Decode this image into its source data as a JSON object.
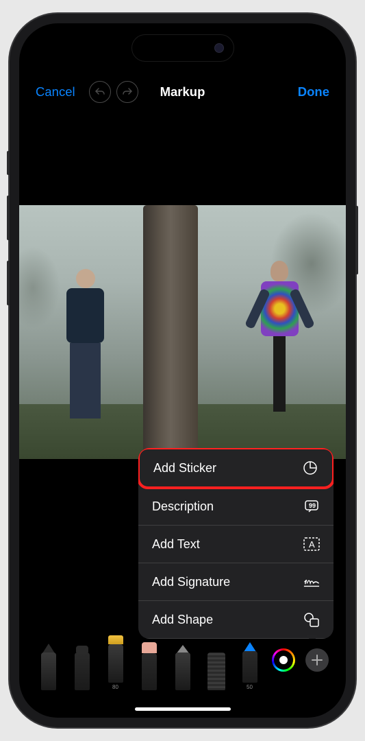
{
  "nav": {
    "cancel": "Cancel",
    "title": "Markup",
    "done": "Done"
  },
  "menu": {
    "items": [
      {
        "label": "Add Sticker",
        "icon": "sticker"
      },
      {
        "label": "Description",
        "icon": "description"
      },
      {
        "label": "Add Text",
        "icon": "text"
      },
      {
        "label": "Add Signature",
        "icon": "signature"
      },
      {
        "label": "Add Shape",
        "icon": "shape"
      }
    ]
  },
  "toolbar": {
    "highlighter_label": "80",
    "bluepen_label": "50"
  }
}
